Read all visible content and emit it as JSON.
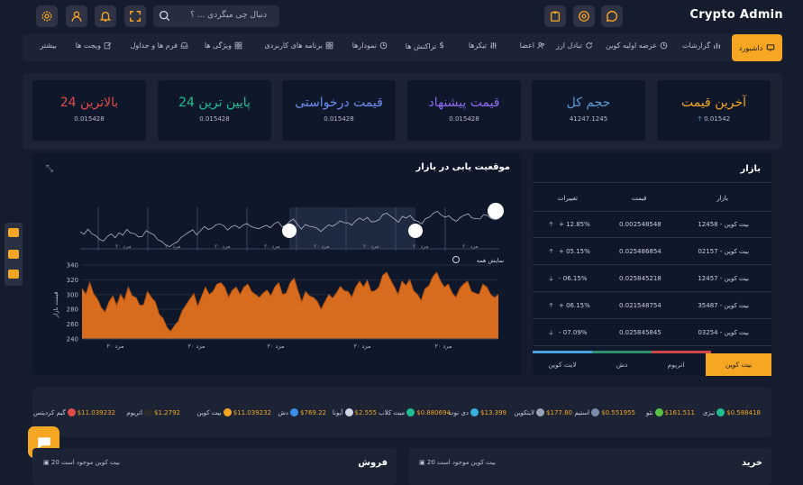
{
  "app": {
    "title": "Crypto Admin"
  },
  "search": {
    "placeholder": "دنبال چی میگردی ... ؟"
  },
  "nav": {
    "active": "داشبورد",
    "items": [
      "گزارشات",
      "عرضه اولیه کوین",
      "تبادل ارز",
      "اعضا",
      "تیکرها",
      "تراکنش ها",
      "نمودارها",
      "برنامه های کاربردی",
      "ویژگی ها",
      "فرم ها و جداول",
      "ویجت ها",
      "بیشتر"
    ]
  },
  "stats": [
    {
      "title": "آخرین قیمت",
      "value": "0.01542",
      "color": "#f5a623",
      "arrow": "up"
    },
    {
      "title": "حجم کل",
      "value": "41247.1245",
      "color": "#5b9bd5"
    },
    {
      "title": "قیمت پیشنهاد",
      "value": "0.015428",
      "color": "#8a6cf0"
    },
    {
      "title": "قیمت درخواستی",
      "value": "0.015428",
      "color": "#6c8df0"
    },
    {
      "title": "پایین ترین 24",
      "value": "0.015428",
      "color": "#1fbf91"
    },
    {
      "title": "بالاترین 24",
      "value": "0.015428",
      "color": "#e24b4b"
    }
  ],
  "chart": {
    "title": "موقعیت یابی در بازار",
    "legend": "نمایش همه",
    "nav_tick": "مرد ۲۰",
    "main_tick": "مرد ۲۰"
  },
  "chart_data": {
    "type": "area",
    "title": "موقعیت یابی در بازار",
    "ylim": [
      240,
      340
    ],
    "yticks": [
      240,
      260,
      280,
      300,
      320,
      340
    ],
    "ylabel": "قیمت بازار",
    "xticks": [
      "مرد ۲۰",
      "مرد ۲۰",
      "مرد ۲۰",
      "مرد ۲۰",
      "مرد ۲۰"
    ],
    "color": "#e8741e",
    "values": [
      308,
      300,
      316,
      301,
      294,
      282,
      276,
      290,
      298,
      285,
      300,
      292,
      310,
      298,
      296,
      285,
      286,
      304,
      296,
      290,
      273,
      268,
      256,
      250,
      258,
      264,
      278,
      286,
      294,
      301,
      284,
      297,
      310,
      300,
      304,
      314,
      316,
      310,
      296,
      306,
      310,
      300,
      310,
      314,
      304,
      300,
      296,
      302,
      306,
      298,
      310,
      316,
      300,
      302,
      316,
      322,
      305,
      290,
      304,
      298,
      296,
      291,
      280,
      290,
      300,
      295,
      302,
      311,
      305,
      304,
      296,
      310,
      318,
      310,
      319,
      304,
      305,
      310,
      326,
      330,
      320,
      310,
      300,
      318,
      312,
      320,
      305,
      300,
      292,
      308,
      312,
      324,
      330,
      318,
      310,
      314,
      302,
      296,
      308,
      314,
      318,
      304,
      302,
      300,
      314,
      310,
      300,
      296,
      300
    ]
  },
  "market": {
    "title": "بازار",
    "headers": {
      "name": "بازار",
      "price": "قیمت",
      "change": "تغییرات"
    },
    "rows": [
      {
        "name": "بیت کوین - 12458",
        "price": "0.002548548",
        "change": "+ 12.85%",
        "dir": "up"
      },
      {
        "name": "بیت کوین - 02157",
        "price": "0.025486854",
        "change": "+ 05.15%",
        "dir": "up"
      },
      {
        "name": "بیت کوین - 12457",
        "price": "0.025845218",
        "change": "- 06.15%",
        "dir": "down"
      },
      {
        "name": "بیت کوین - 35487",
        "price": "0.021548754",
        "change": "+ 06.15%",
        "dir": "up"
      },
      {
        "name": "بیت کوین - 03254",
        "price": "0.025845845",
        "change": "- 07.09%",
        "dir": "down"
      }
    ],
    "tabs": [
      "بیت کوین",
      "اتریوم",
      "دش",
      "لایت کوین"
    ]
  },
  "ticker": [
    {
      "name": "تیزی",
      "price": "$0.588418",
      "color": "#1fbf91"
    },
    {
      "name": "نئو",
      "price": "$161.511",
      "color": "#58c248"
    },
    {
      "name": "استیم",
      "price": "$0.551955",
      "color": "#7d8cad"
    },
    {
      "name": "لایتکوین",
      "price": "$177.80",
      "color": "#9aa3b8"
    },
    {
      "name": "دی نوت",
      "price": "$13.399",
      "color": "#3ab0e0"
    },
    {
      "name": "میت کلاب",
      "price": "$0.880694",
      "color": "#1fbf91"
    },
    {
      "name": "آیونا",
      "price": "$2.555",
      "color": "#cfd6e6"
    },
    {
      "name": "دش",
      "price": "$769.22",
      "color": "#3a8ee6"
    },
    {
      "name": "بیت کوین",
      "price": "$11.039232",
      "color": "#f5a623"
    },
    {
      "name": "اتریوم",
      "price": "$1.2792",
      "color": "#2a2a2a"
    },
    {
      "name": "گیم کردیتس",
      "price": "$11.039232",
      "color": "#e24b4b"
    }
  ],
  "buy": {
    "title": "خرید",
    "note": "20 بیت کوین موجود است"
  },
  "sell": {
    "title": "فروش",
    "note": "20 بیت کوین موجود است"
  }
}
